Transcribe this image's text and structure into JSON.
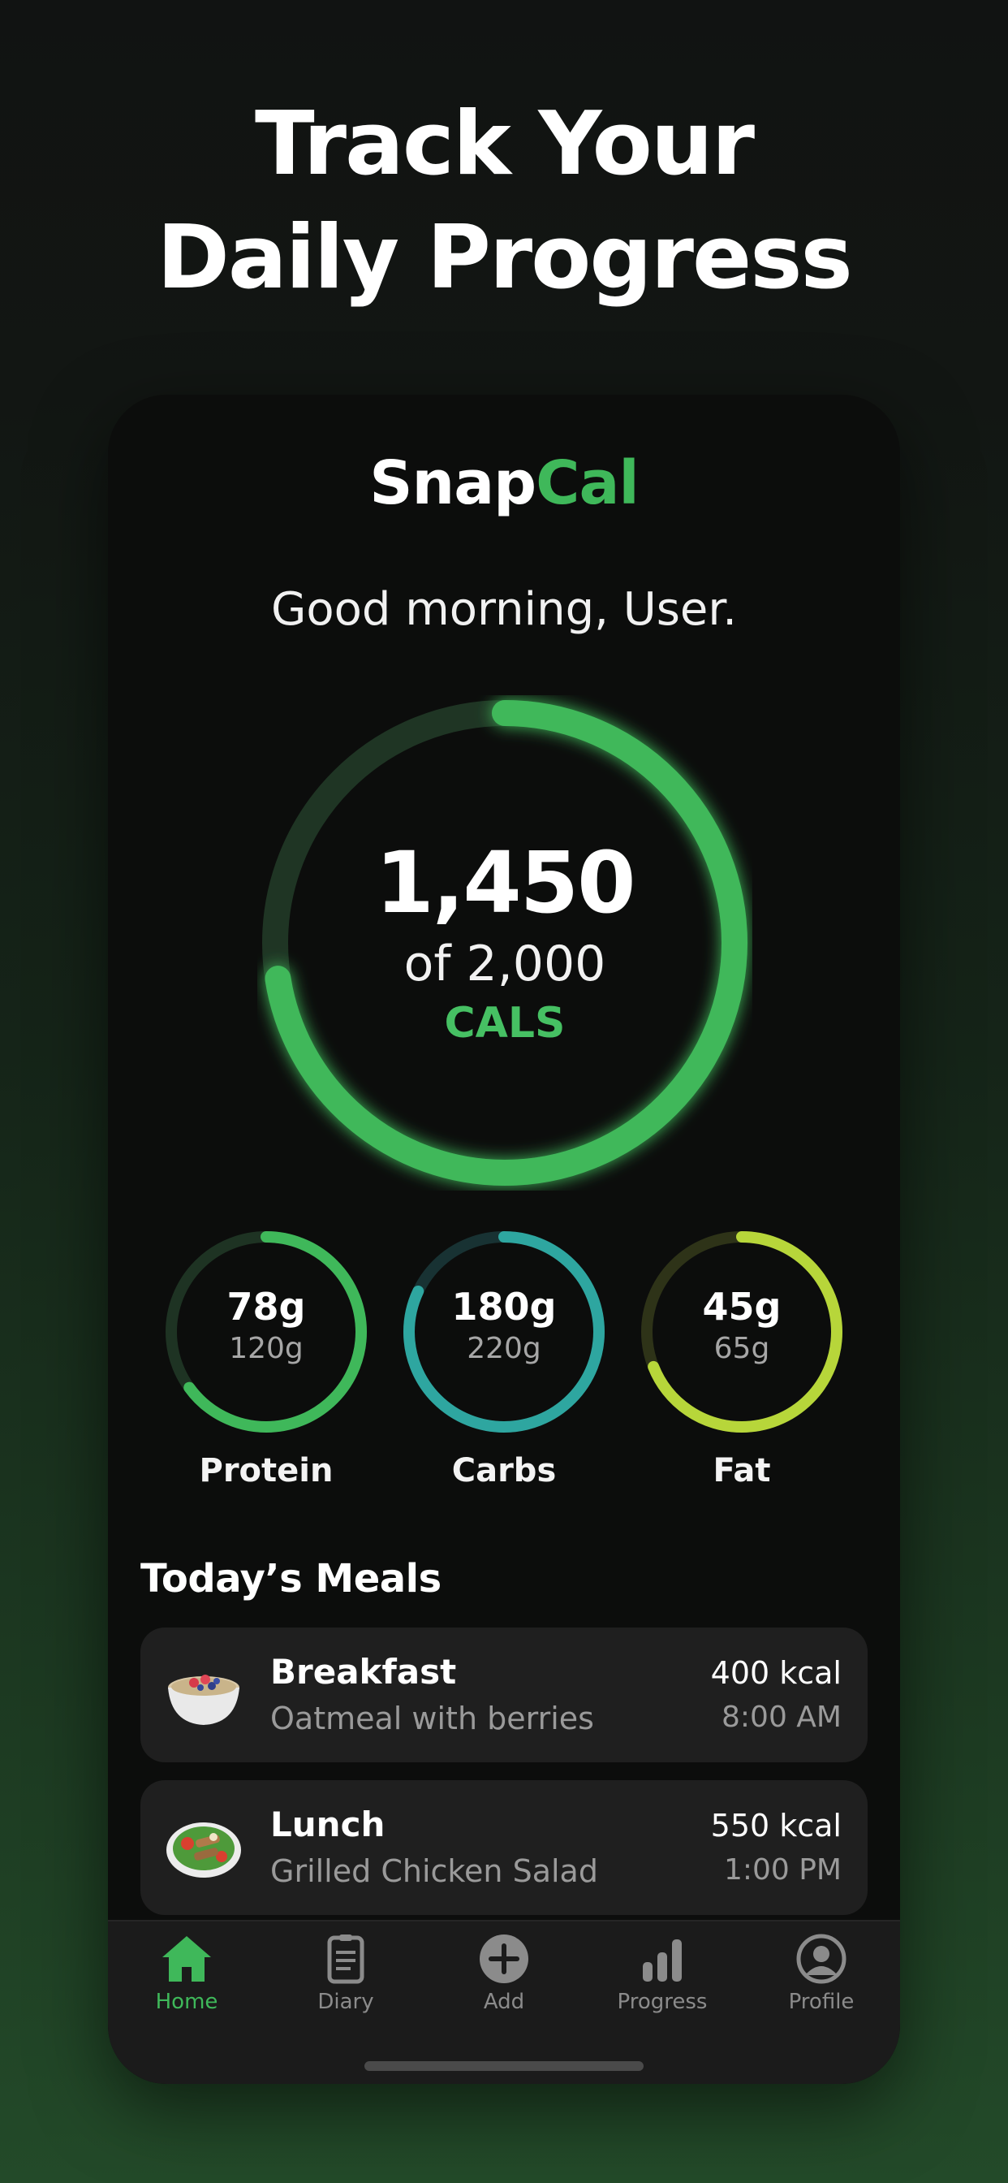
{
  "headline": {
    "line1": "Track Your",
    "line2": "Daily Progress"
  },
  "app": {
    "brand_part1": "Snap",
    "brand_part2": "Cal",
    "greeting": "Good morning, User.",
    "calories": {
      "consumed": "1,450",
      "goal_text": "of 2,000",
      "unit": "CALS",
      "progress": 0.725
    },
    "macros": [
      {
        "value": "78g",
        "target": "120g",
        "label": "Protein",
        "progress": 0.65,
        "color": "#3fb85a"
      },
      {
        "value": "180g",
        "target": "220g",
        "label": "Carbs",
        "progress": 0.82,
        "color": "#2ea6a0"
      },
      {
        "value": "45g",
        "target": "65g",
        "label": "Fat",
        "progress": 0.69,
        "color": "#b7d63a"
      }
    ],
    "meals_title": "Today’s Meals",
    "meals": [
      {
        "name": "Breakfast",
        "description": "Oatmeal with berries",
        "kcal": "400 kcal",
        "time": "8:00 AM",
        "icon": "oatmeal-bowl-icon"
      },
      {
        "name": "Lunch",
        "description": "Grilled Chicken Salad",
        "kcal": "550 kcal",
        "time": "1:00 PM",
        "icon": "chicken-salad-icon"
      }
    ],
    "tabs": [
      {
        "label": "Home",
        "icon": "home-icon",
        "active": true
      },
      {
        "label": "Diary",
        "icon": "diary-icon",
        "active": false
      },
      {
        "label": "Add",
        "icon": "add-icon",
        "active": false
      },
      {
        "label": "Progress",
        "icon": "progress-icon",
        "active": false
      },
      {
        "label": "Profile",
        "icon": "profile-icon",
        "active": false
      }
    ],
    "colors": {
      "accent": "#3fb85a",
      "background": "#0c0d0c",
      "card": "#1f1f1f"
    }
  }
}
